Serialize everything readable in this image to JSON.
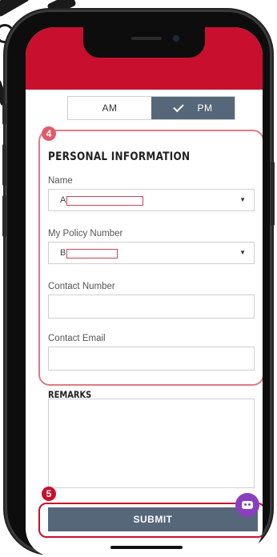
{
  "time_toggle": {
    "am_label": "AM",
    "pm_label": "PM",
    "selected": "PM"
  },
  "annotations": {
    "step4": "4",
    "step5": "5"
  },
  "personal_info": {
    "title": "PERSONAL INFORMATION",
    "name_label": "Name",
    "name_value": "A",
    "policy_label": "My Policy Number",
    "policy_value": "B",
    "contact_number_label": "Contact Number",
    "contact_number_value": "",
    "contact_email_label": "Contact Email",
    "contact_email_value": ""
  },
  "remarks": {
    "label": "REMARKS",
    "value": ""
  },
  "submit_label": "SUBMIT",
  "icons": {
    "check": "check-icon",
    "dropdown": "chevron-down-icon",
    "chat": "chatbot-icon"
  },
  "colors": {
    "brand_red": "#c8102e",
    "button_slate": "#56677a",
    "chat_purple": "#8a3fbf"
  }
}
